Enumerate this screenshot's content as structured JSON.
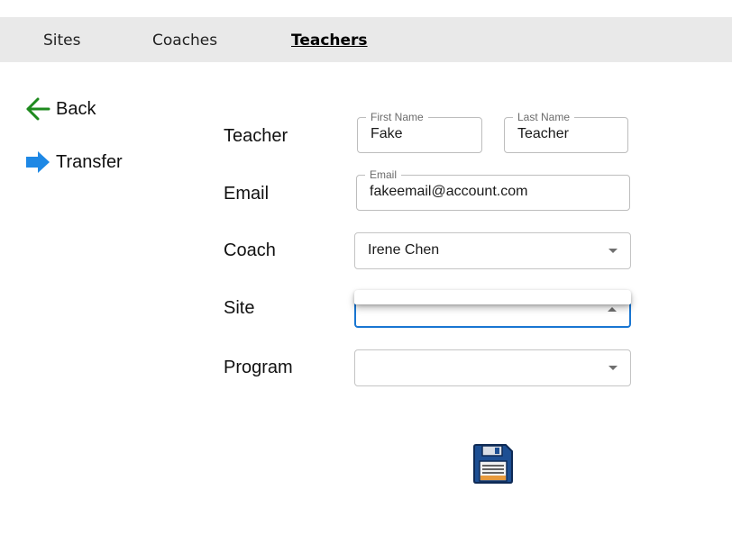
{
  "nav": {
    "tabs": [
      {
        "label": "Sites"
      },
      {
        "label": "Coaches"
      },
      {
        "label": "Teachers"
      }
    ]
  },
  "sidebar": {
    "back_label": "Back",
    "transfer_label": "Transfer"
  },
  "form": {
    "teacher_label": "Teacher",
    "first_name": {
      "legend": "First Name",
      "value": "Fake"
    },
    "last_name": {
      "legend": "Last Name",
      "value": "Teacher"
    },
    "email_label": "Email",
    "email": {
      "legend": "Email",
      "value": "fakeemail@account.com"
    },
    "coach_label": "Coach",
    "coach_value": "Irene Chen",
    "site_label": "Site",
    "site_value": "",
    "program_label": "Program",
    "program_value": ""
  },
  "colors": {
    "back_arrow": "#1e8a1e",
    "transfer_arrow": "#1e88e5",
    "focus_border": "#1976d2",
    "nav_bg": "#e9e9e9"
  },
  "icons": {
    "back": "arrow-left-icon",
    "transfer": "arrow-right-icon",
    "save": "floppy-disk-icon"
  }
}
